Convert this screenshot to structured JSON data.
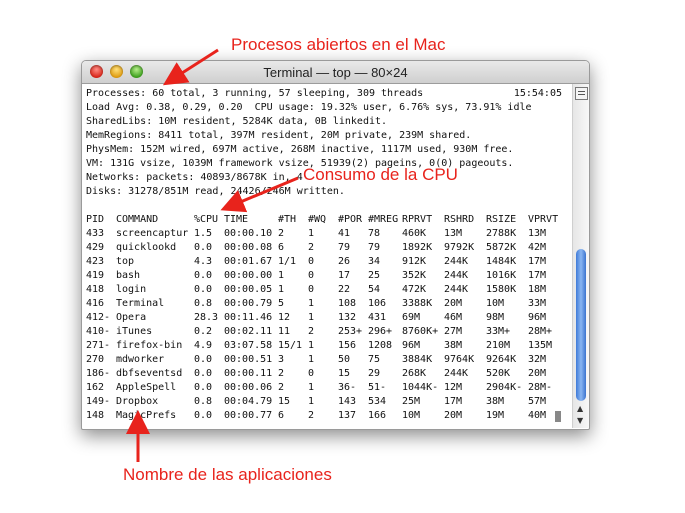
{
  "annotations": {
    "top": "Procesos abiertos en el Mac",
    "middle": "Consumo de la CPU",
    "bottom": "Nombre de las aplicaciones",
    "color": "#e8231c"
  },
  "window": {
    "title": "Terminal — top — 80×24"
  },
  "summary": {
    "processes": "Processes: 60 total, 3 running, 57 sleeping, 309 threads",
    "time": "15:54:05",
    "load": "Load Avg: 0.38, 0.29, 0.20  CPU usage: 19.32% user, 6.76% sys, 73.91% idle",
    "sharedlibs": "SharedLibs: 10M resident, 5284K data, 0B linkedit.",
    "memregions": "MemRegions: 8411 total, 397M resident, 20M private, 239M shared.",
    "physmem": "PhysMem: 152M wired, 697M active, 268M inactive, 1117M used, 930M free.",
    "vm": "VM: 131G vsize, 1039M framework vsize, 51939(2) pageins, 0(0) pageouts.",
    "networks": "Networks: packets: 40893/8678K in, 4",
    "disks": "Disks: 31278/851M read, 24426/246M written."
  },
  "columns": [
    "PID",
    "COMMAND",
    "%CPU",
    "TIME",
    "#TH",
    "#WQ",
    "#POR",
    "#MREG",
    "RPRVT",
    "RSHRD",
    "RSIZE",
    "VPRVT"
  ],
  "rows": [
    [
      "433",
      "screencaptur",
      "1.5",
      "00:00.10",
      "2",
      "1",
      "41",
      "78",
      "460K",
      "13M",
      "2788K",
      "13M"
    ],
    [
      "429",
      "quicklookd",
      "0.0",
      "00:00.08",
      "6",
      "2",
      "79",
      "79",
      "1892K",
      "9792K",
      "5872K",
      "42M"
    ],
    [
      "423",
      "top",
      "4.3",
      "00:01.67",
      "1/1",
      "0",
      "26",
      "34",
      "912K",
      "244K",
      "1484K",
      "17M"
    ],
    [
      "419",
      "bash",
      "0.0",
      "00:00.00",
      "1",
      "0",
      "17",
      "25",
      "352K",
      "244K",
      "1016K",
      "17M"
    ],
    [
      "418",
      "login",
      "0.0",
      "00:00.05",
      "1",
      "0",
      "22",
      "54",
      "472K",
      "244K",
      "1580K",
      "18M"
    ],
    [
      "416",
      "Terminal",
      "0.8",
      "00:00.79",
      "5",
      "1",
      "108",
      "106",
      "3388K",
      "20M",
      "10M",
      "33M"
    ],
    [
      "412-",
      "Opera",
      "28.3",
      "00:11.46",
      "12",
      "1",
      "132",
      "431",
      "69M",
      "46M",
      "98M",
      "96M"
    ],
    [
      "410-",
      "iTunes",
      "0.2",
      "00:02.11",
      "11",
      "2",
      "253+",
      "296+",
      "8760K+",
      "27M",
      "33M+",
      "28M+"
    ],
    [
      "271-",
      "firefox-bin",
      "4.9",
      "03:07.58",
      "15/1",
      "1",
      "156",
      "1208",
      "96M",
      "38M",
      "210M",
      "135M"
    ],
    [
      "270",
      "mdworker",
      "0.0",
      "00:00.51",
      "3",
      "1",
      "50",
      "75",
      "3884K",
      "9764K",
      "9264K",
      "32M"
    ],
    [
      "186-",
      "dbfseventsd",
      "0.0",
      "00:00.11",
      "2",
      "0",
      "15",
      "29",
      "268K",
      "244K",
      "520K",
      "20M"
    ],
    [
      "162",
      "AppleSpell",
      "0.0",
      "00:00.06",
      "2",
      "1",
      "36-",
      "51-",
      "1044K-",
      "12M",
      "2904K-",
      "28M-"
    ],
    [
      "149-",
      "Dropbox",
      "0.8",
      "00:04.79",
      "15",
      "1",
      "143",
      "534",
      "25M",
      "17M",
      "38M",
      "57M"
    ],
    [
      "148",
      "MagicPrefs",
      "0.0",
      "00:00.77",
      "6",
      "2",
      "137",
      "166",
      "10M",
      "20M",
      "19M",
      "40M"
    ]
  ]
}
